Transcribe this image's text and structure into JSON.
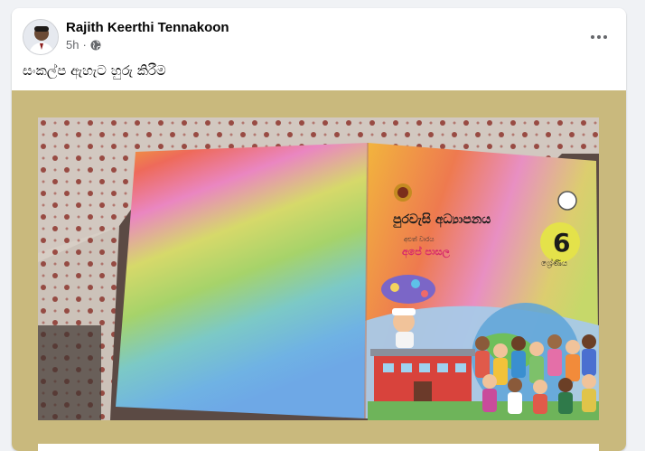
{
  "post": {
    "author": "Rajith Keerthi Tennakoon",
    "time": "5h",
    "separator": "·",
    "privacy_icon": "globe-icon",
    "more_icon": "more-options-icon",
    "caption": "සංකල්ප ඇහැට හුරු කිරීම"
  },
  "book_cover": {
    "title": "පුරවැසි අධ්‍යාපනය",
    "subtitle_small": "අළුත් වාරය",
    "subtitle": "අපේ පාසල",
    "grade_number": "6",
    "grade_label": "ශ්‍රේණිය"
  },
  "colors": {
    "card_bg": "#ffffff",
    "page_bg": "#f0f2f5",
    "media_bg": "#c9b97d",
    "secondary_text": "#65676b"
  }
}
